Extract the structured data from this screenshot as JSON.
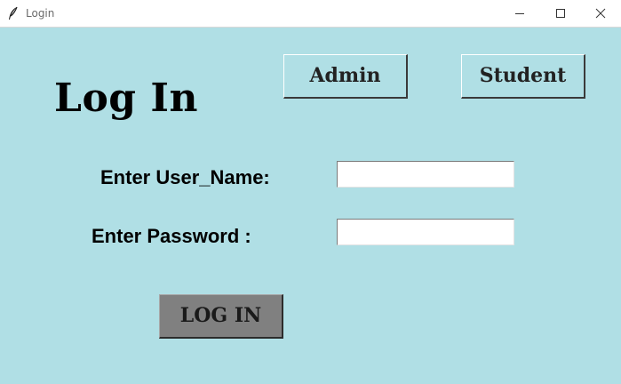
{
  "window": {
    "title": "Login",
    "app_icon": "feather-icon",
    "controls": [
      "minimize-icon",
      "maximize-icon",
      "close-icon"
    ]
  },
  "form": {
    "heading": "Log In",
    "admin_label": "Admin",
    "student_label": "Student",
    "username_label": "Enter User_Name:",
    "username_value": "",
    "password_label": "Enter Password :",
    "password_value": "",
    "submit_label": "LOG IN"
  },
  "colors": {
    "background": "#b0dfe5",
    "submit_button": "#808080",
    "titlebar": "#ffffff"
  }
}
